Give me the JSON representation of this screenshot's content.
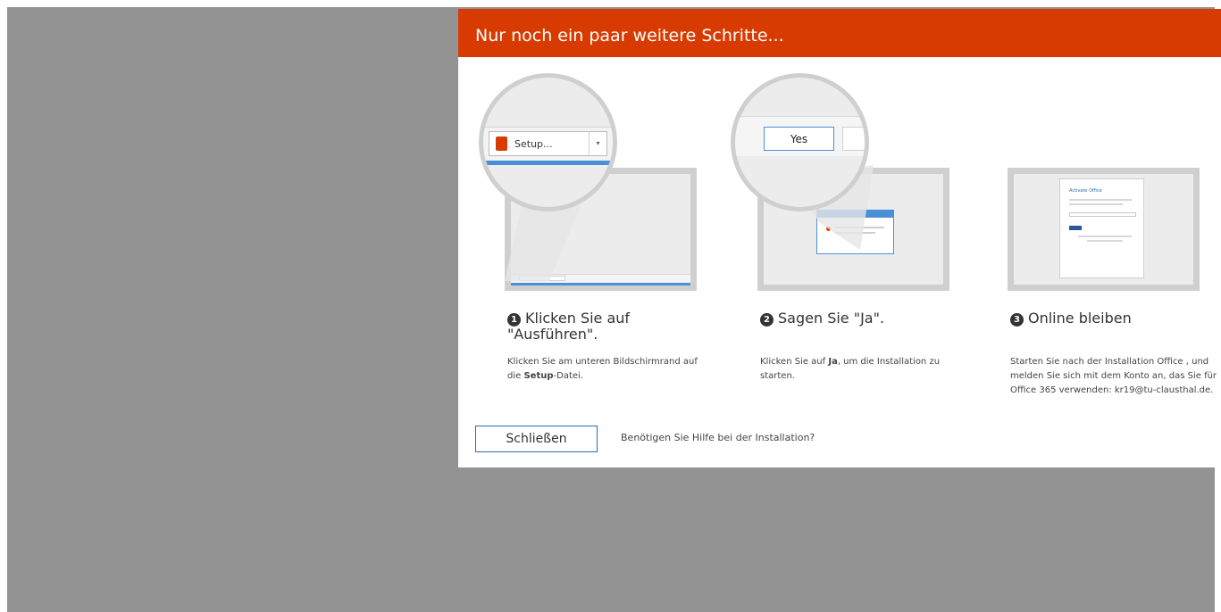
{
  "dialog": {
    "title": "Nur noch ein paar weitere Schritte...",
    "colors": {
      "header": "#d83b01",
      "backdrop": "#939393",
      "button_border": "#2b6cb0"
    },
    "steps": [
      {
        "number": "1",
        "title": "Klicken Sie auf \"Ausführen\".",
        "description_parts": [
          "Klicken Sie am unteren Bildschirmrand auf die ",
          "Setup",
          "-Datei."
        ],
        "illustration": {
          "button_label": "Setup...",
          "icon": "office-logo-icon"
        }
      },
      {
        "number": "2",
        "title": "Sagen Sie \"Ja\".",
        "description_parts": [
          "Klicken Sie auf ",
          "Ja",
          ", um die Installation zu starten."
        ],
        "illustration": {
          "button_label": "Yes",
          "icon": "dialog-window-icon"
        }
      },
      {
        "number": "3",
        "title": "Online bleiben",
        "description_parts": [
          "Starten Sie nach der Installation Office , und melden Sie sich mit dem Konto an, das Sie für Office 365 verwenden: kr19@tu-clausthal.de."
        ],
        "illustration": {
          "window_title": "Activate Office",
          "icon": "activate-window-icon"
        }
      }
    ],
    "close_label": "Schließen",
    "help_label": "Benötigen Sie Hilfe bei der Installation?"
  }
}
